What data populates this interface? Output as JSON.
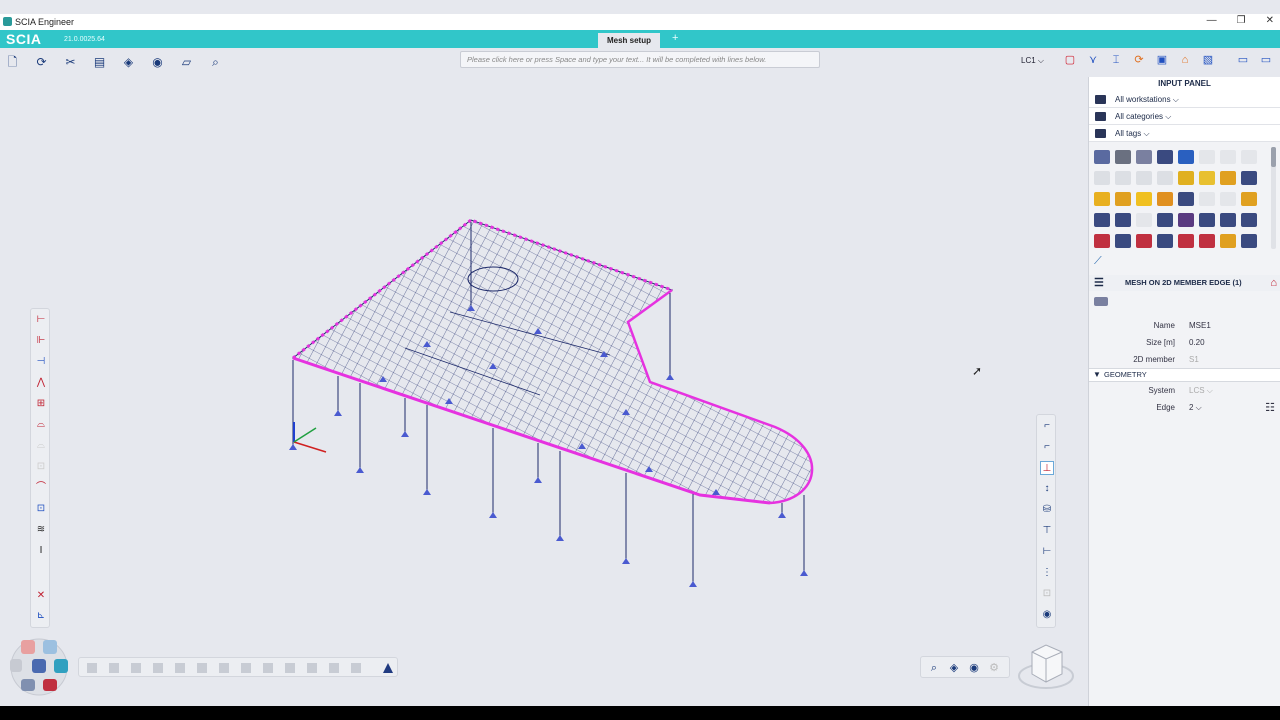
{
  "window": {
    "title": "SCIA Engineer"
  },
  "app": {
    "brand": "SCIA",
    "version": "21.0.0025.64",
    "active_tab": "Mesh setup",
    "add_tab": "+"
  },
  "command_line": {
    "placeholder": "Please click here or press Space and type your text... It will be completed with lines below."
  },
  "load_case": "LC1",
  "input_panel": {
    "title": "INPUT PANEL",
    "filters": [
      {
        "label": "All workstations"
      },
      {
        "label": "All categories"
      },
      {
        "label": "All tags"
      }
    ]
  },
  "properties": {
    "title": "MESH ON 2D MEMBER EDGE (1)",
    "fields": [
      {
        "key": "Name",
        "value": "MSE1"
      },
      {
        "key": "Size [m]",
        "value": "0.20"
      },
      {
        "key": "2D member",
        "value": "S1"
      }
    ],
    "section": "GEOMETRY",
    "geometry": [
      {
        "key": "System",
        "value": "LCS"
      },
      {
        "key": "Edge",
        "value": "2"
      }
    ]
  },
  "colors": {
    "accent": "#31c6c9",
    "mesh": "#1e2a6a",
    "edge_highlight": "#e632e0",
    "support": "#4a5ad0"
  },
  "icons": {
    "toolbar": [
      "new-file-icon",
      "open-file-icon",
      "tools-icon",
      "project-icon",
      "model-icon",
      "view-icon",
      "layers-icon",
      "search-icon"
    ],
    "view": [
      "zoom-icon",
      "view-3d-icon",
      "visibility-icon",
      "settings-icon"
    ]
  }
}
